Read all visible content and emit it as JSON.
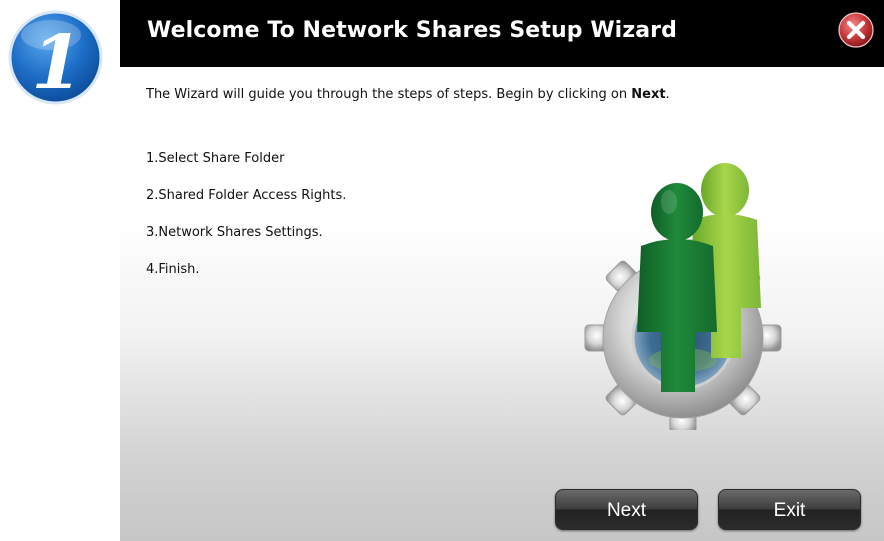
{
  "step_badge": {
    "number": "1",
    "color": "#1e6fc8"
  },
  "dialog": {
    "title": "Welcome To Network Shares Setup Wizard",
    "close_icon": "close-x-icon",
    "intro_text": "The Wizard will guide you through the steps of steps. Begin by clicking on ",
    "intro_bold": "Next",
    "intro_end": ".",
    "steps": [
      "1.Select Share Folder",
      "2.Shared Folder Access Rights.",
      "3.Network Shares Settings.",
      "4.Finish."
    ],
    "illustration_icon": "users-gear-icon",
    "buttons": {
      "next": "Next",
      "exit": "Exit"
    }
  },
  "colors": {
    "titlebar": "#000000",
    "close_button": "#c8393b",
    "button": "#333333",
    "user_front": "#1f8a3a",
    "user_back": "#8cc63f"
  }
}
